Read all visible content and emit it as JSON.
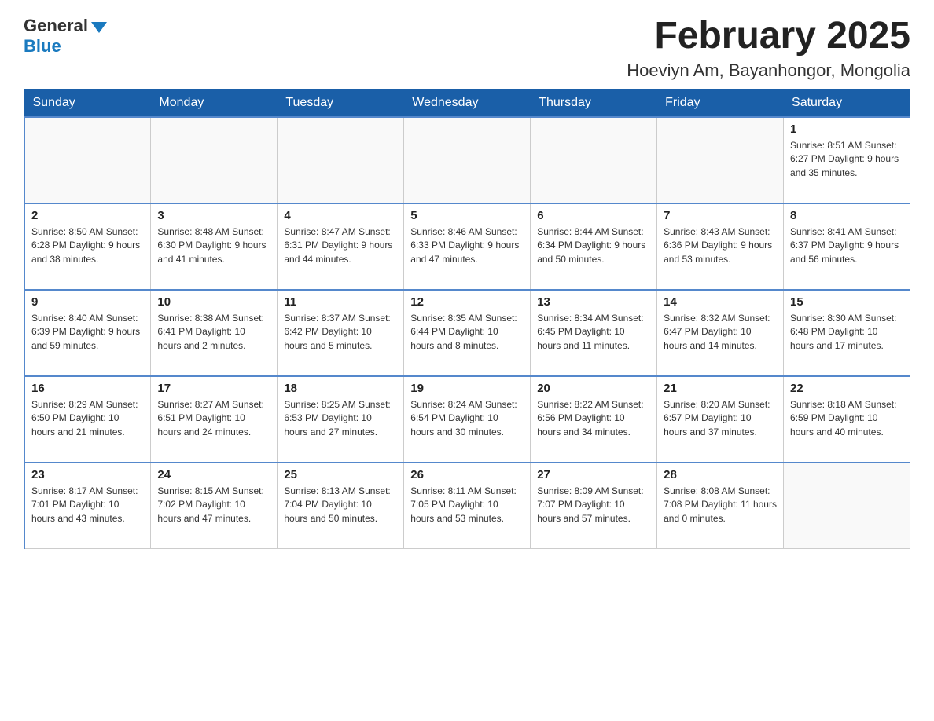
{
  "logo": {
    "general": "General",
    "blue": "Blue"
  },
  "title": "February 2025",
  "subtitle": "Hoeviyn Am, Bayanhongor, Mongolia",
  "weekdays": [
    "Sunday",
    "Monday",
    "Tuesday",
    "Wednesday",
    "Thursday",
    "Friday",
    "Saturday"
  ],
  "weeks": [
    [
      {
        "day": "",
        "info": ""
      },
      {
        "day": "",
        "info": ""
      },
      {
        "day": "",
        "info": ""
      },
      {
        "day": "",
        "info": ""
      },
      {
        "day": "",
        "info": ""
      },
      {
        "day": "",
        "info": ""
      },
      {
        "day": "1",
        "info": "Sunrise: 8:51 AM\nSunset: 6:27 PM\nDaylight: 9 hours and 35 minutes."
      }
    ],
    [
      {
        "day": "2",
        "info": "Sunrise: 8:50 AM\nSunset: 6:28 PM\nDaylight: 9 hours and 38 minutes."
      },
      {
        "day": "3",
        "info": "Sunrise: 8:48 AM\nSunset: 6:30 PM\nDaylight: 9 hours and 41 minutes."
      },
      {
        "day": "4",
        "info": "Sunrise: 8:47 AM\nSunset: 6:31 PM\nDaylight: 9 hours and 44 minutes."
      },
      {
        "day": "5",
        "info": "Sunrise: 8:46 AM\nSunset: 6:33 PM\nDaylight: 9 hours and 47 minutes."
      },
      {
        "day": "6",
        "info": "Sunrise: 8:44 AM\nSunset: 6:34 PM\nDaylight: 9 hours and 50 minutes."
      },
      {
        "day": "7",
        "info": "Sunrise: 8:43 AM\nSunset: 6:36 PM\nDaylight: 9 hours and 53 minutes."
      },
      {
        "day": "8",
        "info": "Sunrise: 8:41 AM\nSunset: 6:37 PM\nDaylight: 9 hours and 56 minutes."
      }
    ],
    [
      {
        "day": "9",
        "info": "Sunrise: 8:40 AM\nSunset: 6:39 PM\nDaylight: 9 hours and 59 minutes."
      },
      {
        "day": "10",
        "info": "Sunrise: 8:38 AM\nSunset: 6:41 PM\nDaylight: 10 hours and 2 minutes."
      },
      {
        "day": "11",
        "info": "Sunrise: 8:37 AM\nSunset: 6:42 PM\nDaylight: 10 hours and 5 minutes."
      },
      {
        "day": "12",
        "info": "Sunrise: 8:35 AM\nSunset: 6:44 PM\nDaylight: 10 hours and 8 minutes."
      },
      {
        "day": "13",
        "info": "Sunrise: 8:34 AM\nSunset: 6:45 PM\nDaylight: 10 hours and 11 minutes."
      },
      {
        "day": "14",
        "info": "Sunrise: 8:32 AM\nSunset: 6:47 PM\nDaylight: 10 hours and 14 minutes."
      },
      {
        "day": "15",
        "info": "Sunrise: 8:30 AM\nSunset: 6:48 PM\nDaylight: 10 hours and 17 minutes."
      }
    ],
    [
      {
        "day": "16",
        "info": "Sunrise: 8:29 AM\nSunset: 6:50 PM\nDaylight: 10 hours and 21 minutes."
      },
      {
        "day": "17",
        "info": "Sunrise: 8:27 AM\nSunset: 6:51 PM\nDaylight: 10 hours and 24 minutes."
      },
      {
        "day": "18",
        "info": "Sunrise: 8:25 AM\nSunset: 6:53 PM\nDaylight: 10 hours and 27 minutes."
      },
      {
        "day": "19",
        "info": "Sunrise: 8:24 AM\nSunset: 6:54 PM\nDaylight: 10 hours and 30 minutes."
      },
      {
        "day": "20",
        "info": "Sunrise: 8:22 AM\nSunset: 6:56 PM\nDaylight: 10 hours and 34 minutes."
      },
      {
        "day": "21",
        "info": "Sunrise: 8:20 AM\nSunset: 6:57 PM\nDaylight: 10 hours and 37 minutes."
      },
      {
        "day": "22",
        "info": "Sunrise: 8:18 AM\nSunset: 6:59 PM\nDaylight: 10 hours and 40 minutes."
      }
    ],
    [
      {
        "day": "23",
        "info": "Sunrise: 8:17 AM\nSunset: 7:01 PM\nDaylight: 10 hours and 43 minutes."
      },
      {
        "day": "24",
        "info": "Sunrise: 8:15 AM\nSunset: 7:02 PM\nDaylight: 10 hours and 47 minutes."
      },
      {
        "day": "25",
        "info": "Sunrise: 8:13 AM\nSunset: 7:04 PM\nDaylight: 10 hours and 50 minutes."
      },
      {
        "day": "26",
        "info": "Sunrise: 8:11 AM\nSunset: 7:05 PM\nDaylight: 10 hours and 53 minutes."
      },
      {
        "day": "27",
        "info": "Sunrise: 8:09 AM\nSunset: 7:07 PM\nDaylight: 10 hours and 57 minutes."
      },
      {
        "day": "28",
        "info": "Sunrise: 8:08 AM\nSunset: 7:08 PM\nDaylight: 11 hours and 0 minutes."
      },
      {
        "day": "",
        "info": ""
      }
    ]
  ]
}
